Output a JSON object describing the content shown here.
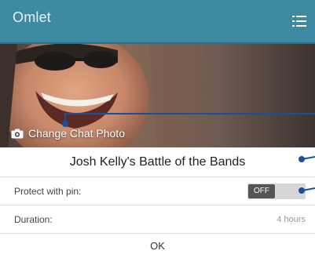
{
  "app_bar": {
    "title": "Omlet",
    "menu_icon": "menu-list-icon",
    "background": "#3f8aa3"
  },
  "photo": {
    "change_label": "Change Chat Photo",
    "icon": "camera-icon"
  },
  "chat": {
    "name": "Josh Kelly's Battle of the Bands"
  },
  "settings": {
    "pin_label": "Protect with pin:",
    "pin_state": "OFF",
    "duration_label": "Duration:",
    "duration_value": "4 hours"
  },
  "dialog": {
    "ok_label": "OK"
  },
  "colors": {
    "callout": "#1a4f9c",
    "divider": "#dddddd"
  }
}
